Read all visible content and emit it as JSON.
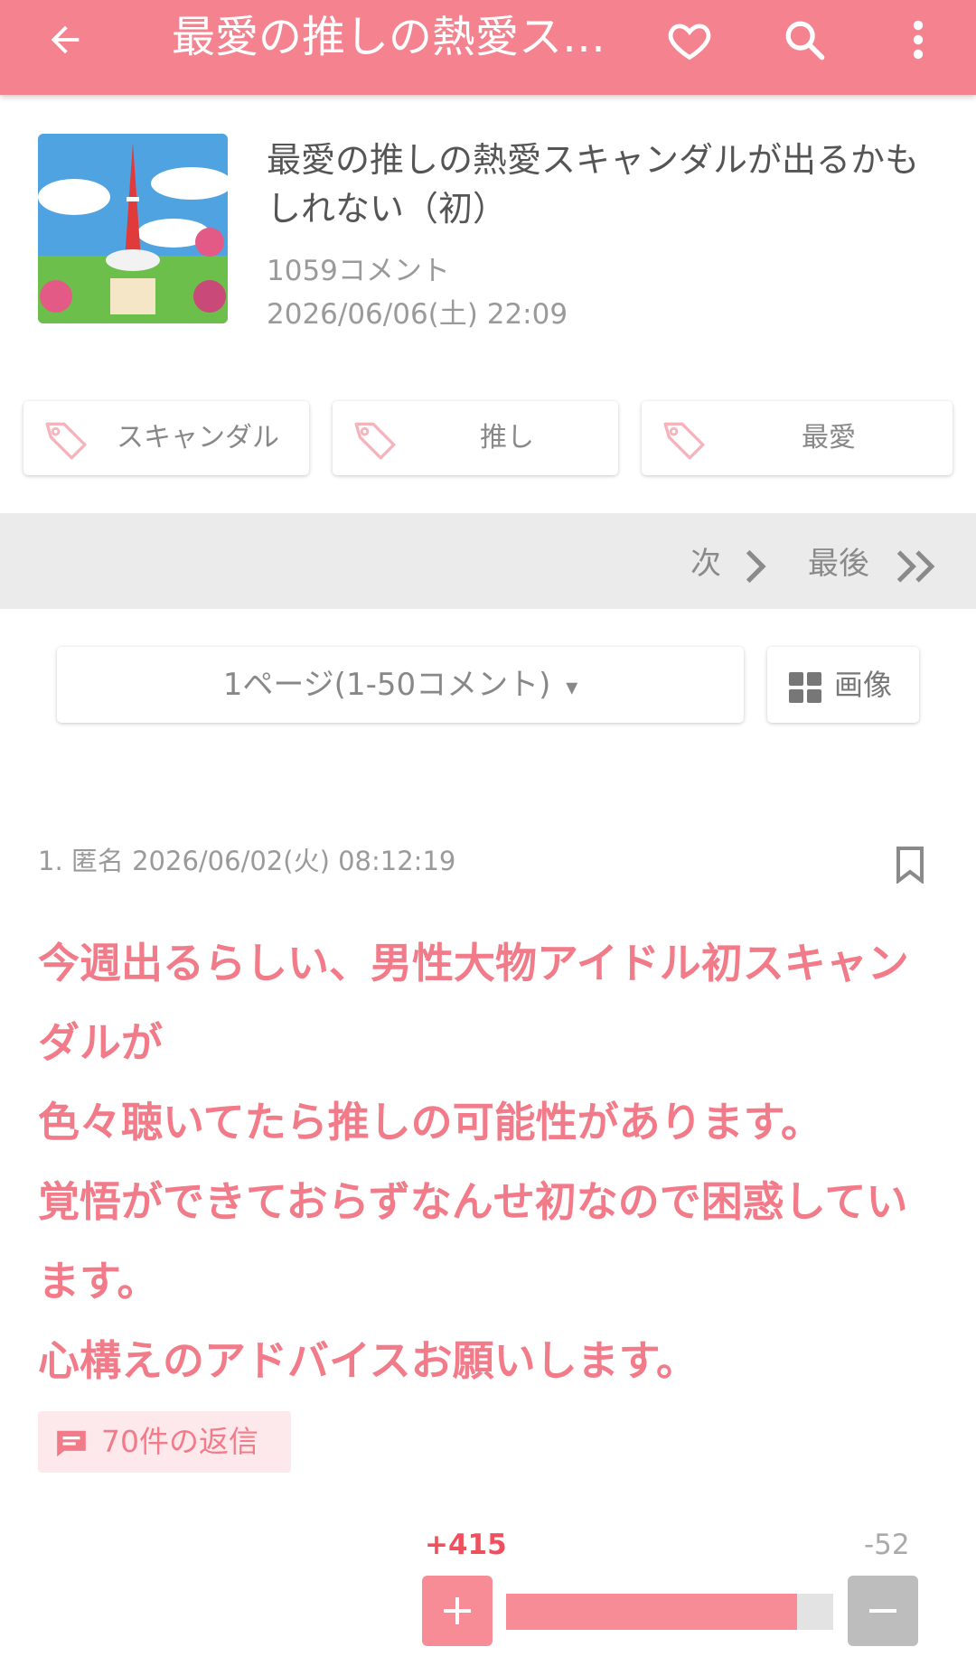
{
  "appbar": {
    "title": "最愛の推しの熱愛スキャンダルが出るかもしれない（初）",
    "icons": [
      "arrow-back-icon",
      "heart-icon",
      "search-icon",
      "more-vert-icon"
    ]
  },
  "post": {
    "title": "最愛の推しの熱愛スキャンダルが出るかもしれない（初）",
    "comments": "1059コメント",
    "date": "2026/06/06(土) 22:09"
  },
  "tags": [
    "スキャンダル",
    "推し",
    "最愛"
  ],
  "pager": {
    "next": "次",
    "last": "最後"
  },
  "page_select": {
    "label": "1ページ(1-50コメント)",
    "arrow": "▾"
  },
  "image_button": {
    "label": "画像"
  },
  "comment": {
    "meta": "1. 匿名 2026/06/02(火) 08:12:19",
    "body": "今週出るらしい、男性大物アイドル初スキャンダルが\n色々聴いてたら推しの可能性があります。\n覚悟ができておらずなんせ初なので困惑しています。\n心構えのアドバイスお願いします。",
    "replies": "70件の返信",
    "plus": "+415",
    "minus": "-52",
    "plus_ratio": 0.889
  },
  "colors": {
    "accent": "#f4838f",
    "text_pink": "#f27b89",
    "plus": "#f0505e",
    "minus_btn": "#bdbdbd"
  }
}
